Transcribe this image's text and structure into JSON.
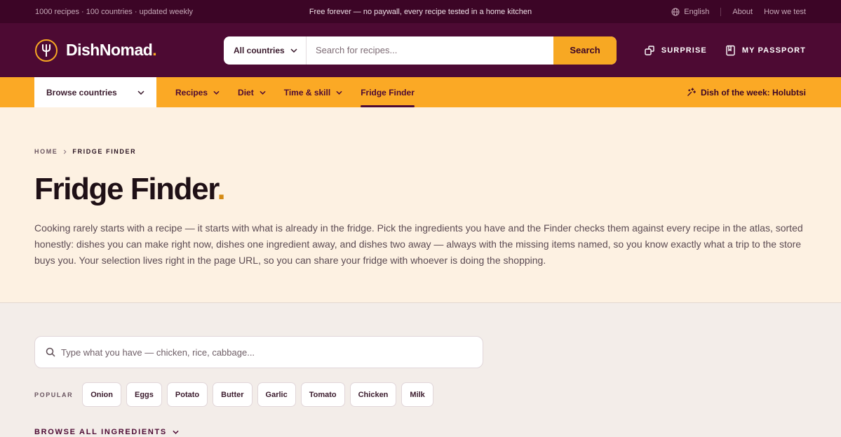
{
  "topbar": {
    "stats": "1000 recipes · 100 countries · updated weekly",
    "tagline": "Free forever — no paywall, every recipe tested in a home kitchen",
    "language": "English",
    "about": "About",
    "how_we_test": "How we test"
  },
  "header": {
    "brand": "DishNomad",
    "brand_dot": ".",
    "country_select": "All countries",
    "search_placeholder": "Search for recipes...",
    "search_button": "Search",
    "surprise": "SURPRISE",
    "passport": "MY PASSPORT"
  },
  "nav": {
    "browse": "Browse countries",
    "items": [
      {
        "label": "Recipes"
      },
      {
        "label": "Diet"
      },
      {
        "label": "Time & skill"
      },
      {
        "label": "Fridge Finder"
      }
    ],
    "dish_of_week": "Dish of the week: Holubtsi"
  },
  "hero": {
    "breadcrumb_home": "HOME",
    "breadcrumb_current": "FRIDGE FINDER",
    "title": "Fridge Finder",
    "title_dot": ".",
    "intro": "Cooking rarely starts with a recipe — it starts with what is already in the fridge. Pick the ingredients you have and the Finder checks them against every recipe in the atlas, sorted honestly: dishes you can make right now, dishes one ingredient away, and dishes two away — always with the missing items named, so you know exactly what a trip to the store buys you. Your selection lives right in the page URL, so you can share your fridge with whoever is doing the shopping."
  },
  "finder": {
    "input_placeholder": "Type what you have — chicken, rice, cabbage...",
    "popular_label": "POPULAR",
    "chips": [
      "Onion",
      "Eggs",
      "Potato",
      "Butter",
      "Garlic",
      "Tomato",
      "Chicken",
      "Milk"
    ],
    "browse_all": "BROWSE ALL INGREDIENTS"
  },
  "colors": {
    "topbar_bg": "#3c0526",
    "header_bg": "#4d0a33",
    "accent": "#fba925",
    "hero_bg": "#fdf1e2",
    "page_bg": "#f3ede9"
  },
  "icons": [
    "globe-icon",
    "fork-logo-icon",
    "chevron-down-icon",
    "shuffle-icon",
    "passport-icon",
    "sparkle-icon",
    "search-icon",
    "chevron-right-icon"
  ]
}
